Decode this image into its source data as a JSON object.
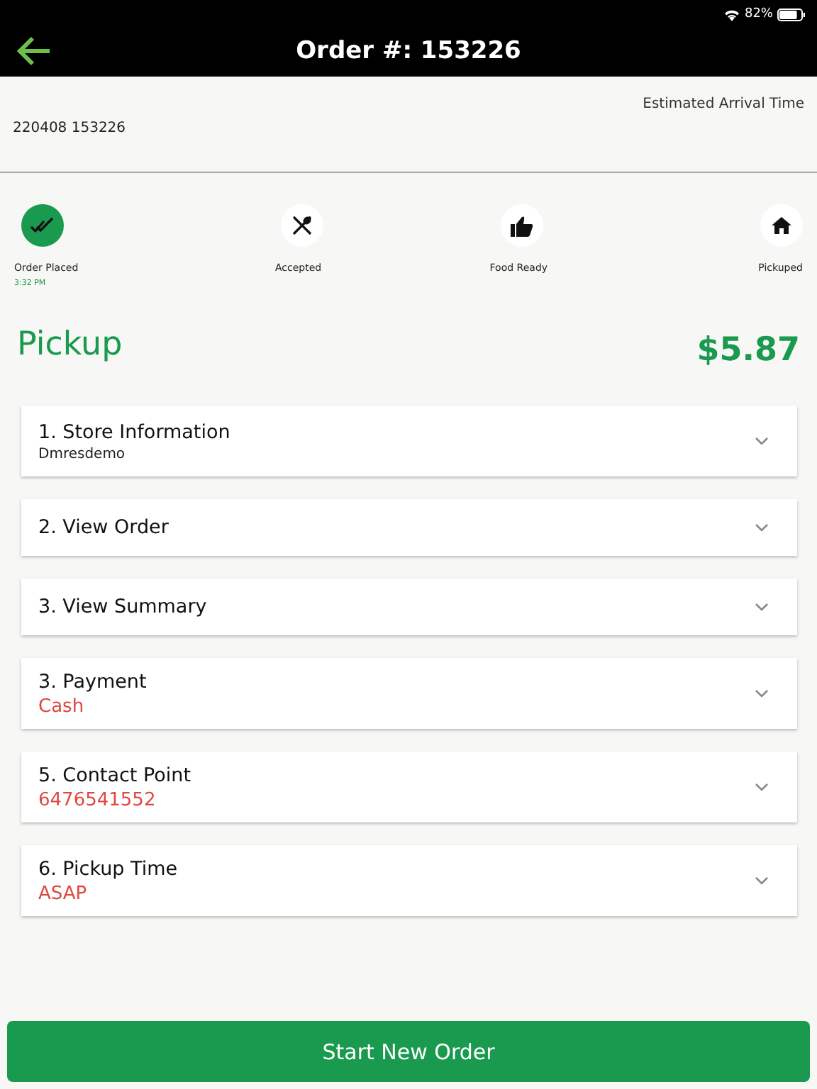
{
  "status_bar": {
    "battery": "82%"
  },
  "header": {
    "title": "Order #: 153226"
  },
  "info": {
    "eta_label": "Estimated Arrival Time",
    "order_code": "220408 153226"
  },
  "steps": [
    {
      "kind": "check",
      "label": "Order Placed",
      "time": "3:32 PM",
      "done": true
    },
    {
      "kind": "utensils",
      "label": "Accepted",
      "done": false
    },
    {
      "kind": "thumb",
      "label": "Food Ready",
      "done": false
    },
    {
      "kind": "home",
      "label": "Pickuped",
      "done": false
    }
  ],
  "order_type": "Pickup",
  "total": "$5.87",
  "sections": [
    {
      "kind": "plain",
      "title": "1. Store Information",
      "detail": "Dmresdemo",
      "expanded": false
    },
    {
      "title": "2. View Order",
      "expanded": false
    },
    {
      "title": "3. View Summary",
      "expanded": false
    },
    {
      "kind": "highlight",
      "title": "3. Payment",
      "detail": "Cash",
      "expanded": false
    },
    {
      "kind": "highlight",
      "title": "5. Contact Point",
      "detail": "6476541552",
      "expanded": false
    },
    {
      "kind": "highlight",
      "title": "6. Pickup Time",
      "detail": "ASAP",
      "expanded": false
    }
  ],
  "action": {
    "label": "Start New Order"
  }
}
